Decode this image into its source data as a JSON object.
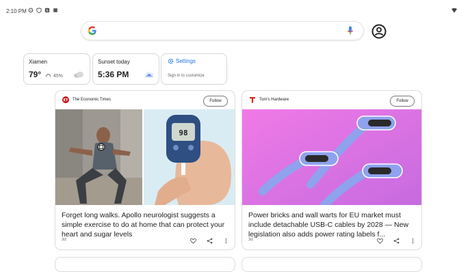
{
  "status": {
    "time": "2:10 PM"
  },
  "chips": {
    "weather": {
      "city": "Xiamen",
      "temp": "79°",
      "humidity": "45%"
    },
    "sunset": {
      "label": "Sunset today",
      "time": "5:36 PM"
    },
    "settings": {
      "label": "Settings",
      "sub": "Sign in to customize"
    }
  },
  "cards": [
    {
      "source": "The Economic Times",
      "follow": "Follow",
      "title": "Forget long walks. Apollo neurologist suggests a simple exercise to do at home that can protect your heart and sugar levels",
      "age": "3d",
      "meter_reading": "98"
    },
    {
      "source": "Tom's Hardware",
      "follow": "Follow",
      "title": "Power bricks and wall warts for EU market must include detachable USB-C cables by 2028 — New legislation also adds power rating labels f...",
      "age": "3d"
    }
  ],
  "colors": {
    "accent": "#1a73e8",
    "text": "#202124",
    "border": "#dcdcdc",
    "card_bg": "#ffffff"
  }
}
